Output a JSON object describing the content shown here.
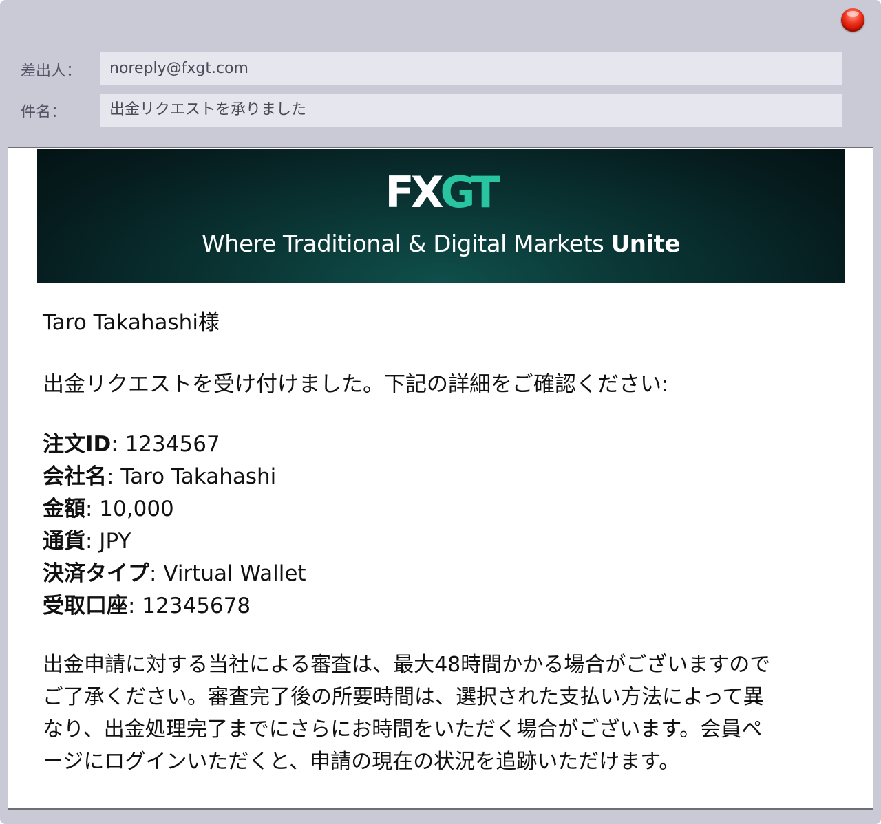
{
  "window": {
    "close_button_color": "#e5281a"
  },
  "header": {
    "from_label": "差出人：",
    "from_value": "noreply@fxgt.com",
    "subject_label": "件名：",
    "subject_value": "出金リクエストを承りました"
  },
  "banner": {
    "logo_part1": "FX",
    "logo_part2": "GT",
    "tagline_regular": "Where Traditional & Digital Markets",
    "tagline_bold": "Unite",
    "background_color": "#06282a",
    "logo_accent_color": "#29c5a1"
  },
  "email": {
    "greeting": "Taro Takahashi様",
    "intro": "出金リクエストを受け付けました。下記の詳細をご確認ください:",
    "details": [
      {
        "label": "注文ID",
        "value": ": 1234567"
      },
      {
        "label": "会社名",
        "value": ": Taro Takahashi"
      },
      {
        "label": "金額",
        "value": ": 10,000"
      },
      {
        "label": "通貨",
        "value": ": JPY"
      },
      {
        "label": "決済タイプ",
        "value": ": Virtual Wallet"
      },
      {
        "label": "受取口座",
        "value": ": 12345678"
      }
    ],
    "notice_lines": [
      "出金申請に対する当社による審査は、最大48時間かかる場合がございますので",
      "ご了承ください。審査完了後の所要時間は、選択された支払い方法によって異",
      "なり、出金処理完了までにさらにお時間をいただく場合がございます。会員ペ",
      "ージにログインいただくと、申請の現在の状況を追跡いただけます。"
    ]
  }
}
